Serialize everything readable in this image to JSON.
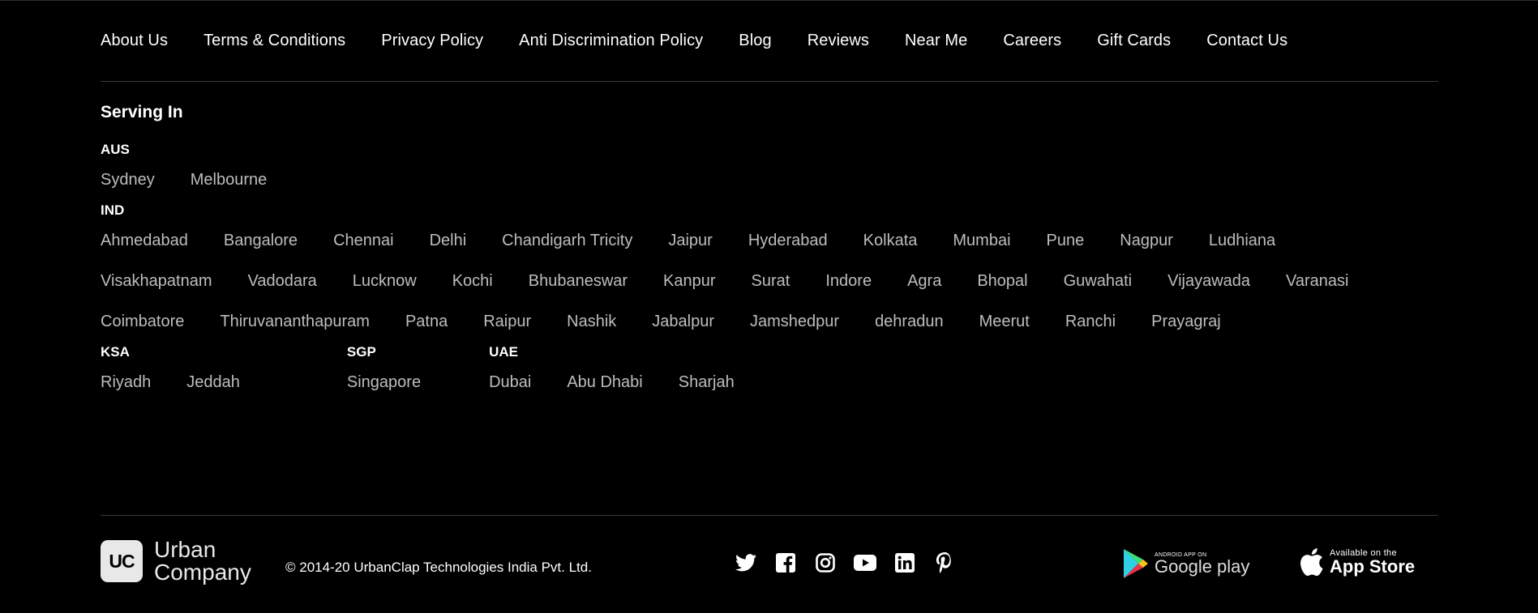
{
  "nav": [
    "About Us",
    "Terms & Conditions",
    "Privacy Policy",
    "Anti Discrimination Policy",
    "Blog",
    "Reviews",
    "Near Me",
    "Careers",
    "Gift Cards",
    "Contact Us"
  ],
  "serving": {
    "title": "Serving In",
    "aus": {
      "label": "AUS",
      "cities": [
        "Sydney",
        "Melbourne"
      ]
    },
    "ind": {
      "label": "IND",
      "cities": [
        "Ahmedabad",
        "Bangalore",
        "Chennai",
        "Delhi",
        "Chandigarh Tricity",
        "Jaipur",
        "Hyderabad",
        "Kolkata",
        "Mumbai",
        "Pune",
        "Nagpur",
        "Ludhiana",
        "Visakhapatnam",
        "Vadodara",
        "Lucknow",
        "Kochi",
        "Bhubaneswar",
        "Kanpur",
        "Surat",
        "Indore",
        "Agra",
        "Bhopal",
        "Guwahati",
        "Vijayawada",
        "Varanasi",
        "Coimbatore",
        "Thiruvananthapuram",
        "Patna",
        "Raipur",
        "Nashik",
        "Jabalpur",
        "Jamshedpur",
        "dehradun",
        "Meerut",
        "Ranchi",
        "Prayagraj"
      ]
    },
    "ksa": {
      "label": "KSA",
      "cities": [
        "Riyadh",
        "Jeddah"
      ]
    },
    "sgp": {
      "label": "SGP",
      "cities": [
        "Singapore"
      ]
    },
    "uae": {
      "label": "UAE",
      "cities": [
        "Dubai",
        "Abu Dhabi",
        "Sharjah"
      ]
    }
  },
  "footer": {
    "logo_mark": "UC",
    "logo_line1": "Urban",
    "logo_line2": "Company",
    "copyright": "© 2014-20 UrbanClap Technologies India Pvt. Ltd.",
    "socials": [
      "twitter-icon",
      "facebook-icon",
      "instagram-icon",
      "youtube-icon",
      "linkedin-icon",
      "pinterest-icon"
    ],
    "google_play": {
      "small": "ANDROID APP ON",
      "large": "Google play"
    },
    "app_store": {
      "small": "Available on the",
      "large": "App Store"
    }
  }
}
